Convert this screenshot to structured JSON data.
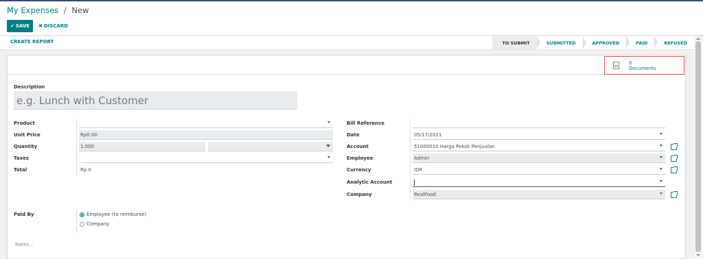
{
  "breadcrumb": {
    "parent": "My Expenses",
    "separator": "/",
    "current": "New"
  },
  "toolbar": {
    "save_label": "SAVE",
    "discard_label": "DISCARD"
  },
  "actions": {
    "create_report": "CREATE REPORT"
  },
  "statusbar": {
    "stages": [
      "TO SUBMIT",
      "SUBMITTED",
      "APPROVED",
      "PAID",
      "REFUSED"
    ],
    "current": "TO SUBMIT"
  },
  "smart_button": {
    "count": "0",
    "label": "Documents",
    "icon": "document-icon"
  },
  "form": {
    "description_label": "Description",
    "description_placeholder": "e.g. Lunch with Customer",
    "product_label": "Product",
    "product_value": "",
    "unit_price_label": "Unit Price",
    "unit_price_value": "Rp0.00",
    "quantity_label": "Quantity",
    "quantity_value": "1.000",
    "uom_value": "",
    "taxes_label": "Taxes",
    "taxes_value": "",
    "total_label": "Total",
    "total_value": "Rp 0",
    "bill_reference_label": "Bill Reference",
    "bill_reference_value": "",
    "date_label": "Date",
    "date_value": "05/17/2021",
    "account_label": "Account",
    "account_value": "51000010 Harga Pokok Penjualan",
    "employee_label": "Employee",
    "employee_value": "Admin",
    "currency_label": "Currency",
    "currency_value": "IDR",
    "analytic_label": "Analytic Account",
    "analytic_value": "",
    "company_label": "Company",
    "company_value": "RealFood",
    "paid_by_label": "Paid By",
    "paid_by_options": [
      "Employee (to reimburse)",
      "Company"
    ],
    "paid_by_selected": "Employee (to reimburse)",
    "notes_placeholder": "Notes..."
  },
  "colors": {
    "primary": "#017e84",
    "highlight_border": "#d9534f",
    "readonly_field": "#e9ecef"
  }
}
